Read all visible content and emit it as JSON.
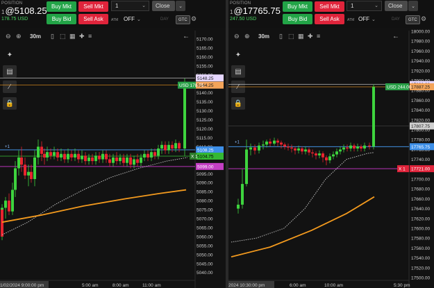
{
  "left": {
    "position": {
      "label": "POSITION",
      "qty": "1",
      "price": "@5108.25",
      "pnl": "178.75 USD"
    },
    "buttons": {
      "buy_mkt": "Buy Mkt",
      "sell_mkt": "Sell Mkt",
      "buy_bid": "Buy Bid",
      "sell_ask": "Sell Ask",
      "close": "Close"
    },
    "qty_value": "1",
    "atm_label": "ATM",
    "atm_value": "OFF",
    "tif_day": "DAY",
    "tif_gtc": "GTC",
    "interval": "30m",
    "price_axis": [
      "5170.00",
      "5165.00",
      "5160.00",
      "5155.00",
      "5150.00",
      "5145.00",
      "5140.00",
      "5135.00",
      "5130.00",
      "5125.00",
      "5120.00",
      "5115.00",
      "5110.00",
      "5105.00",
      "5100.00",
      "5095.00",
      "5090.00",
      "5085.00",
      "5080.00",
      "5075.00",
      "5070.00",
      "5065.00",
      "5060.00",
      "5055.00",
      "5050.00",
      "5045.00",
      "5040.00"
    ],
    "tags": {
      "purple_top": "5148.25",
      "orange": "5144.25",
      "pnl": "USD 178.75",
      "blue": "5108.25",
      "last": "5104.75",
      "x_label": "X 1",
      "magenta": "5099.00",
      "plus": "+1"
    },
    "time_axis": [
      "1/02/2024 9:00:00 pm",
      "5:00 am",
      "8:00 am",
      "11:00 am"
    ],
    "colors": {
      "up": "#3ed43e",
      "down": "#e8242f",
      "orange": "#f39a1e",
      "blue": "#4aa3ff",
      "magenta": "#d23ad2"
    }
  },
  "right": {
    "position": {
      "label": "POSITION",
      "qty": "1",
      "price": "@17765.75",
      "pnl": "247.50 USD"
    },
    "buttons": {
      "buy_mkt": "Buy Mkt",
      "sell_mkt": "Sell Mkt",
      "buy_bid": "Buy Bid",
      "sell_ask": "Sell Ask",
      "close": "Close"
    },
    "qty_value": "1",
    "atm_label": "ATM",
    "atm_value": "OFF",
    "tif_day": "DAY",
    "tif_gtc": "GTC",
    "interval": "30m",
    "price_axis": [
      "18000.00",
      "17980.00",
      "17960.00",
      "17940.00",
      "17920.00",
      "17900.00",
      "17880.00",
      "17860.00",
      "17840.00",
      "17820.00",
      "17800.00",
      "17780.00",
      "17760.00",
      "17740.00",
      "17720.00",
      "17700.00",
      "17680.00",
      "17660.00",
      "17640.00",
      "17620.00",
      "17600.00",
      "17580.00",
      "17560.00",
      "17540.00",
      "17520.00",
      "17500.00"
    ],
    "tags": {
      "purple_top": "17892.00",
      "orange": "17887.25",
      "pnl": "USD 244.00",
      "gray": "17807.75",
      "blue": "17765.75",
      "x_label": "X 1",
      "magenta": "17721.00",
      "plus": "+1"
    },
    "time_axis": [
      "2024 10:30:00 pm",
      "6:00 am",
      "10:00 am",
      "5:30 pm"
    ]
  }
}
